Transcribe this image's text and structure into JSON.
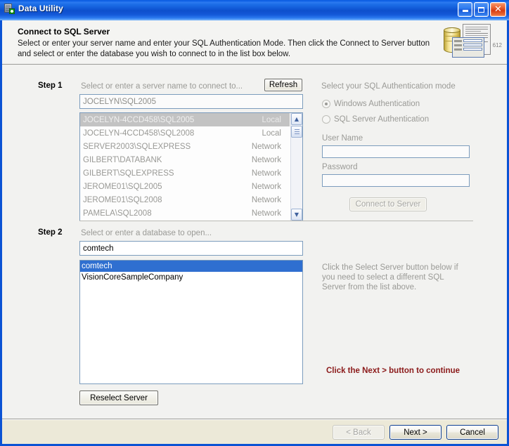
{
  "window": {
    "title": "Data Utility",
    "app_icon": "server-database-add-icon",
    "minimize_label": "Minimize",
    "maximize_label": "Maximize",
    "close_label": "Close"
  },
  "header": {
    "title": "Connect to SQL Server",
    "description": "Select or enter your server name and enter your SQL Authentication Mode.  Then click the Connect to Server button and select or enter the database you wish to connect to in the list box below.",
    "icon": "database-document-form-icon",
    "icon_number": "612"
  },
  "step1": {
    "label": "Step 1",
    "caption": "Select or enter a server name to connect to...",
    "refresh_button": "Refresh",
    "server_input_value": "JOCELYN\\SQL2005",
    "server_input_placeholder": "Select or enter a server name",
    "servers": [
      {
        "name": "JOCELYN-4CCD458\\SQL2005",
        "type": "Local",
        "selected": true
      },
      {
        "name": "JOCELYN-4CCD458\\SQL2008",
        "type": "Local",
        "selected": false
      },
      {
        "name": "SERVER2003\\SQLEXPRESS",
        "type": "Network",
        "selected": false
      },
      {
        "name": "GILBERT\\DATABANK",
        "type": "Network",
        "selected": false
      },
      {
        "name": "GILBERT\\SQLEXPRESS",
        "type": "Network",
        "selected": false
      },
      {
        "name": "JEROME01\\SQL2005",
        "type": "Network",
        "selected": false
      },
      {
        "name": "JEROME01\\SQL2008",
        "type": "Network",
        "selected": false
      },
      {
        "name": "PAMELA\\SQL2008",
        "type": "Network",
        "selected": false
      }
    ],
    "scroll_up_glyph": "▲",
    "scroll_down_glyph": "▼"
  },
  "auth": {
    "title": "Select your SQL Authentication mode",
    "windows_auth_label": "Windows Authentication",
    "sql_auth_label": "SQL Server Authentication",
    "selected_mode": "windows",
    "username_label": "User Name",
    "username_value": "",
    "password_label": "Password",
    "password_value": "",
    "connect_button": "Connect to Server"
  },
  "step2": {
    "label": "Step 2",
    "caption": "Select or enter a database to open...",
    "database_input_value": "comtech",
    "database_input_placeholder": "Select or enter a database",
    "databases": [
      {
        "name": "comtech",
        "selected": true
      },
      {
        "name": "VisionCoreSampleCompany",
        "selected": false
      }
    ],
    "reselect_button": "Reselect Server",
    "hint": "Click the Select Server button below if you need to select a different SQL Server from the list above.",
    "red_hint": "Click the Next > button to continue"
  },
  "footer": {
    "back_button": "< Back",
    "next_button": "Next >",
    "cancel_button": "Cancel"
  },
  "colors": {
    "titlebar_blue": "#0f56d4",
    "selection_blue": "#2f6fd0",
    "selection_gray": "#c3c3c3",
    "red_hint": "#8b1a1a",
    "footer_bg": "#ece9d8",
    "disabled_text": "#9a9a96"
  }
}
